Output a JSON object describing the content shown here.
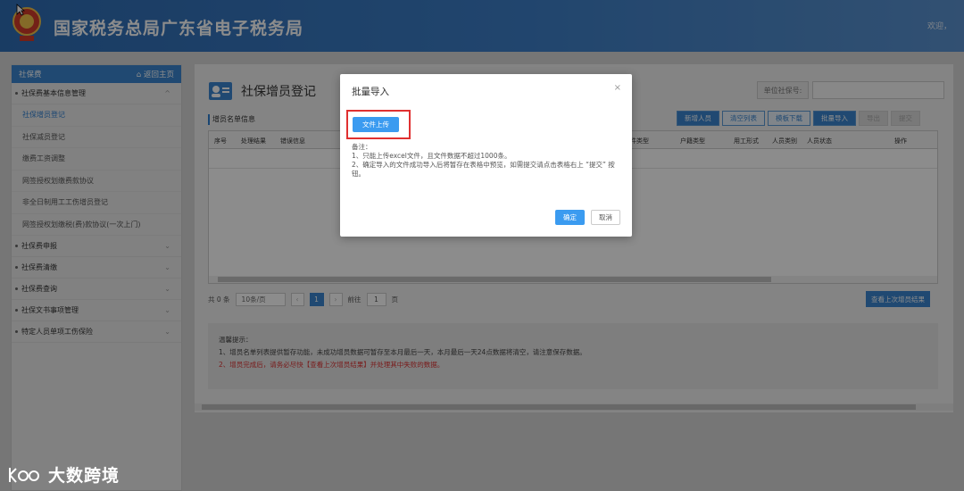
{
  "header": {
    "title": "国家税务总局广东省电子税务局",
    "welcome": "欢迎，"
  },
  "sidebar": {
    "head_label": "社保费",
    "home_link": "⌂ 返回主页",
    "groups": [
      {
        "label": "社保费基本信息管理",
        "chevron": "^"
      },
      {
        "label": "社保费申报",
        "chevron": "⌄"
      },
      {
        "label": "社保费清缴",
        "chevron": "⌄"
      },
      {
        "label": "社保费查询",
        "chevron": "⌄"
      },
      {
        "label": "社保文书事项管理",
        "chevron": "⌄"
      },
      {
        "label": "特定人员单项工伤保险",
        "chevron": "⌄"
      }
    ],
    "items": [
      "社保增员登记",
      "社保减员登记",
      "缴费工资调整",
      "网签授权划缴费款协议",
      "非全日制用工工伤增员登记",
      "网签授权划缴税(费)款协议(一次上门)"
    ]
  },
  "main": {
    "page_title": "社保增员登记",
    "unit_label": "单位社保号:",
    "section_title": "增员名单信息",
    "toolbar": [
      "新增人员",
      "清空列表",
      "模板下载",
      "批量导入",
      "导出",
      "提交"
    ],
    "columns": [
      "序号",
      "处理结果",
      "错误信息",
      "件类型",
      "户籍类型",
      "用工形式",
      "人员类别",
      "人员状态",
      "操作"
    ],
    "pager": {
      "total": "共 0 条",
      "page_size": "10条/页",
      "prev": "‹",
      "page": "1",
      "next": "›",
      "goto_label": "前往",
      "goto_value": "1",
      "page_unit": "页"
    },
    "view_last_result": "查看上次增员结果",
    "tips": {
      "title": "温馨提示：",
      "line1": "1、增员名单列表提供暂存功能，未成功增员数据可暂存至本月最后一天，本月最后一天24点数据将清空，请注意保存数据。",
      "line2": "2、增员完成后，请务必尽快【查看上次增员结果】并处理其中失败的数据。"
    }
  },
  "dialog": {
    "title": "批量导入",
    "close": "×",
    "upload_label": "文件上传",
    "notes_title": "备注：",
    "note1": "1、只能上传excel文件，且文件数据不超过1000条。",
    "note2": "2、确定导入的文件成功导入后将暂存在表格中预览，如需提交请点击表格右上 “提交” 按钮。",
    "ok_label": "确定",
    "cancel_label": "取消"
  },
  "watermark": {
    "text": "大数跨境"
  },
  "colors": {
    "header_blue": "#3a78c1",
    "accent_blue": "#3b86cf",
    "upload_highlight": "#e03030"
  }
}
